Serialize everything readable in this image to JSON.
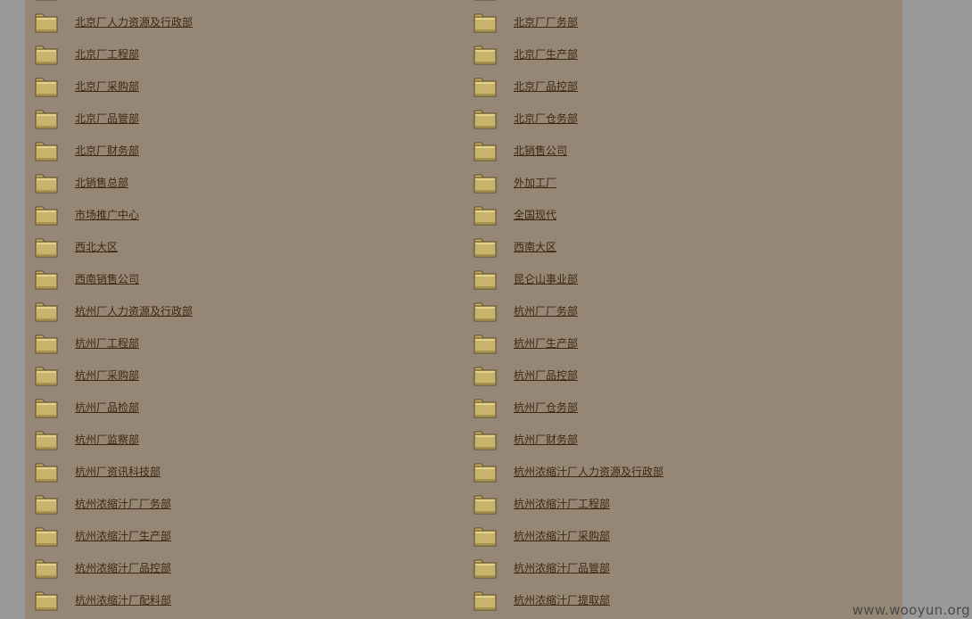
{
  "colors": {
    "page_background": "#9a9a9a",
    "panel_background": "#958676",
    "link_text": "#3e2a12",
    "folder_body": "#c8b36a",
    "folder_border": "#5a4a28"
  },
  "folders": {
    "icon": "folder-icon",
    "left_column": [
      "",
      "北京厂人力资源及行政部",
      "北京厂工程部",
      "北京厂采购部",
      "北京厂品管部",
      "北京厂财务部",
      "北销售总部",
      "市场推广中心",
      "西北大区",
      "西南销售公司",
      "杭州厂人力资源及行政部",
      "杭州厂工程部",
      "杭州厂采购部",
      "杭州厂品检部",
      "杭州厂监察部",
      "杭州厂资讯科技部",
      "杭州浓缩汁厂厂务部",
      "杭州浓缩汁厂生产部",
      "杭州浓缩汁厂品控部",
      "杭州浓缩汁厂配料部"
    ],
    "right_column": [
      "",
      "北京厂厂务部",
      "北京厂生产部",
      "北京厂品控部",
      "北京厂仓务部",
      "北销售公司",
      "外加工厂",
      "全国现代",
      "西南大区",
      "昆仑山事业部",
      "杭州厂厂务部",
      "杭州厂生产部",
      "杭州厂品控部",
      "杭州厂仓务部",
      "杭州厂财务部",
      "杭州浓缩汁厂人力资源及行政部",
      "杭州浓缩汁厂工程部",
      "杭州浓缩汁厂采购部",
      "杭州浓缩汁厂品管部",
      "杭州浓缩汁厂提取部"
    ]
  },
  "watermark": "www.wooyun.org"
}
